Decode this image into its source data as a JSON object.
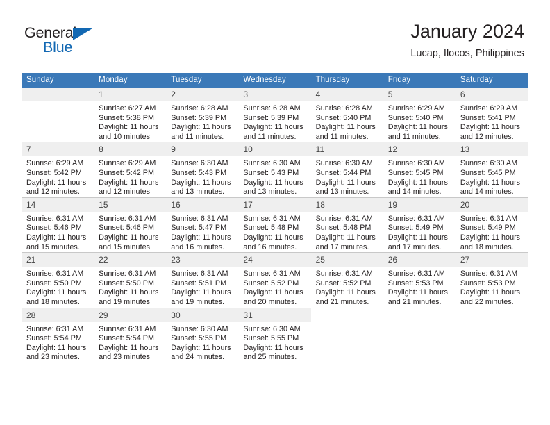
{
  "brand": {
    "name_top": "General",
    "name_bottom": "Blue",
    "triangle_color": "#1268b3"
  },
  "header": {
    "title": "January 2024",
    "subtitle": "Lucap, Ilocos, Philippines"
  },
  "theme": {
    "header_row_bg": "#3b79b8",
    "daynum_bg": "#efefef",
    "grid_line": "#c8c8c8",
    "text": "#231f20"
  },
  "weekdays": [
    "Sunday",
    "Monday",
    "Tuesday",
    "Wednesday",
    "Thursday",
    "Friday",
    "Saturday"
  ],
  "weeks": [
    [
      {
        "day": "",
        "lines": []
      },
      {
        "day": "1",
        "lines": [
          "Sunrise: 6:27 AM",
          "Sunset: 5:38 PM",
          "Daylight: 11 hours",
          "and 10 minutes."
        ]
      },
      {
        "day": "2",
        "lines": [
          "Sunrise: 6:28 AM",
          "Sunset: 5:39 PM",
          "Daylight: 11 hours",
          "and 11 minutes."
        ]
      },
      {
        "day": "3",
        "lines": [
          "Sunrise: 6:28 AM",
          "Sunset: 5:39 PM",
          "Daylight: 11 hours",
          "and 11 minutes."
        ]
      },
      {
        "day": "4",
        "lines": [
          "Sunrise: 6:28 AM",
          "Sunset: 5:40 PM",
          "Daylight: 11 hours",
          "and 11 minutes."
        ]
      },
      {
        "day": "5",
        "lines": [
          "Sunrise: 6:29 AM",
          "Sunset: 5:40 PM",
          "Daylight: 11 hours",
          "and 11 minutes."
        ]
      },
      {
        "day": "6",
        "lines": [
          "Sunrise: 6:29 AM",
          "Sunset: 5:41 PM",
          "Daylight: 11 hours",
          "and 12 minutes."
        ]
      }
    ],
    [
      {
        "day": "7",
        "lines": [
          "Sunrise: 6:29 AM",
          "Sunset: 5:42 PM",
          "Daylight: 11 hours",
          "and 12 minutes."
        ]
      },
      {
        "day": "8",
        "lines": [
          "Sunrise: 6:29 AM",
          "Sunset: 5:42 PM",
          "Daylight: 11 hours",
          "and 12 minutes."
        ]
      },
      {
        "day": "9",
        "lines": [
          "Sunrise: 6:30 AM",
          "Sunset: 5:43 PM",
          "Daylight: 11 hours",
          "and 13 minutes."
        ]
      },
      {
        "day": "10",
        "lines": [
          "Sunrise: 6:30 AM",
          "Sunset: 5:43 PM",
          "Daylight: 11 hours",
          "and 13 minutes."
        ]
      },
      {
        "day": "11",
        "lines": [
          "Sunrise: 6:30 AM",
          "Sunset: 5:44 PM",
          "Daylight: 11 hours",
          "and 13 minutes."
        ]
      },
      {
        "day": "12",
        "lines": [
          "Sunrise: 6:30 AM",
          "Sunset: 5:45 PM",
          "Daylight: 11 hours",
          "and 14 minutes."
        ]
      },
      {
        "day": "13",
        "lines": [
          "Sunrise: 6:30 AM",
          "Sunset: 5:45 PM",
          "Daylight: 11 hours",
          "and 14 minutes."
        ]
      }
    ],
    [
      {
        "day": "14",
        "lines": [
          "Sunrise: 6:31 AM",
          "Sunset: 5:46 PM",
          "Daylight: 11 hours",
          "and 15 minutes."
        ]
      },
      {
        "day": "15",
        "lines": [
          "Sunrise: 6:31 AM",
          "Sunset: 5:46 PM",
          "Daylight: 11 hours",
          "and 15 minutes."
        ]
      },
      {
        "day": "16",
        "lines": [
          "Sunrise: 6:31 AM",
          "Sunset: 5:47 PM",
          "Daylight: 11 hours",
          "and 16 minutes."
        ]
      },
      {
        "day": "17",
        "lines": [
          "Sunrise: 6:31 AM",
          "Sunset: 5:48 PM",
          "Daylight: 11 hours",
          "and 16 minutes."
        ]
      },
      {
        "day": "18",
        "lines": [
          "Sunrise: 6:31 AM",
          "Sunset: 5:48 PM",
          "Daylight: 11 hours",
          "and 17 minutes."
        ]
      },
      {
        "day": "19",
        "lines": [
          "Sunrise: 6:31 AM",
          "Sunset: 5:49 PM",
          "Daylight: 11 hours",
          "and 17 minutes."
        ]
      },
      {
        "day": "20",
        "lines": [
          "Sunrise: 6:31 AM",
          "Sunset: 5:49 PM",
          "Daylight: 11 hours",
          "and 18 minutes."
        ]
      }
    ],
    [
      {
        "day": "21",
        "lines": [
          "Sunrise: 6:31 AM",
          "Sunset: 5:50 PM",
          "Daylight: 11 hours",
          "and 18 minutes."
        ]
      },
      {
        "day": "22",
        "lines": [
          "Sunrise: 6:31 AM",
          "Sunset: 5:50 PM",
          "Daylight: 11 hours",
          "and 19 minutes."
        ]
      },
      {
        "day": "23",
        "lines": [
          "Sunrise: 6:31 AM",
          "Sunset: 5:51 PM",
          "Daylight: 11 hours",
          "and 19 minutes."
        ]
      },
      {
        "day": "24",
        "lines": [
          "Sunrise: 6:31 AM",
          "Sunset: 5:52 PM",
          "Daylight: 11 hours",
          "and 20 minutes."
        ]
      },
      {
        "day": "25",
        "lines": [
          "Sunrise: 6:31 AM",
          "Sunset: 5:52 PM",
          "Daylight: 11 hours",
          "and 21 minutes."
        ]
      },
      {
        "day": "26",
        "lines": [
          "Sunrise: 6:31 AM",
          "Sunset: 5:53 PM",
          "Daylight: 11 hours",
          "and 21 minutes."
        ]
      },
      {
        "day": "27",
        "lines": [
          "Sunrise: 6:31 AM",
          "Sunset: 5:53 PM",
          "Daylight: 11 hours",
          "and 22 minutes."
        ]
      }
    ],
    [
      {
        "day": "28",
        "lines": [
          "Sunrise: 6:31 AM",
          "Sunset: 5:54 PM",
          "Daylight: 11 hours",
          "and 23 minutes."
        ]
      },
      {
        "day": "29",
        "lines": [
          "Sunrise: 6:31 AM",
          "Sunset: 5:54 PM",
          "Daylight: 11 hours",
          "and 23 minutes."
        ]
      },
      {
        "day": "30",
        "lines": [
          "Sunrise: 6:30 AM",
          "Sunset: 5:55 PM",
          "Daylight: 11 hours",
          "and 24 minutes."
        ]
      },
      {
        "day": "31",
        "lines": [
          "Sunrise: 6:30 AM",
          "Sunset: 5:55 PM",
          "Daylight: 11 hours",
          "and 25 minutes."
        ]
      },
      {
        "day": "",
        "lines": []
      },
      {
        "day": "",
        "lines": []
      },
      {
        "day": "",
        "lines": []
      }
    ]
  ]
}
